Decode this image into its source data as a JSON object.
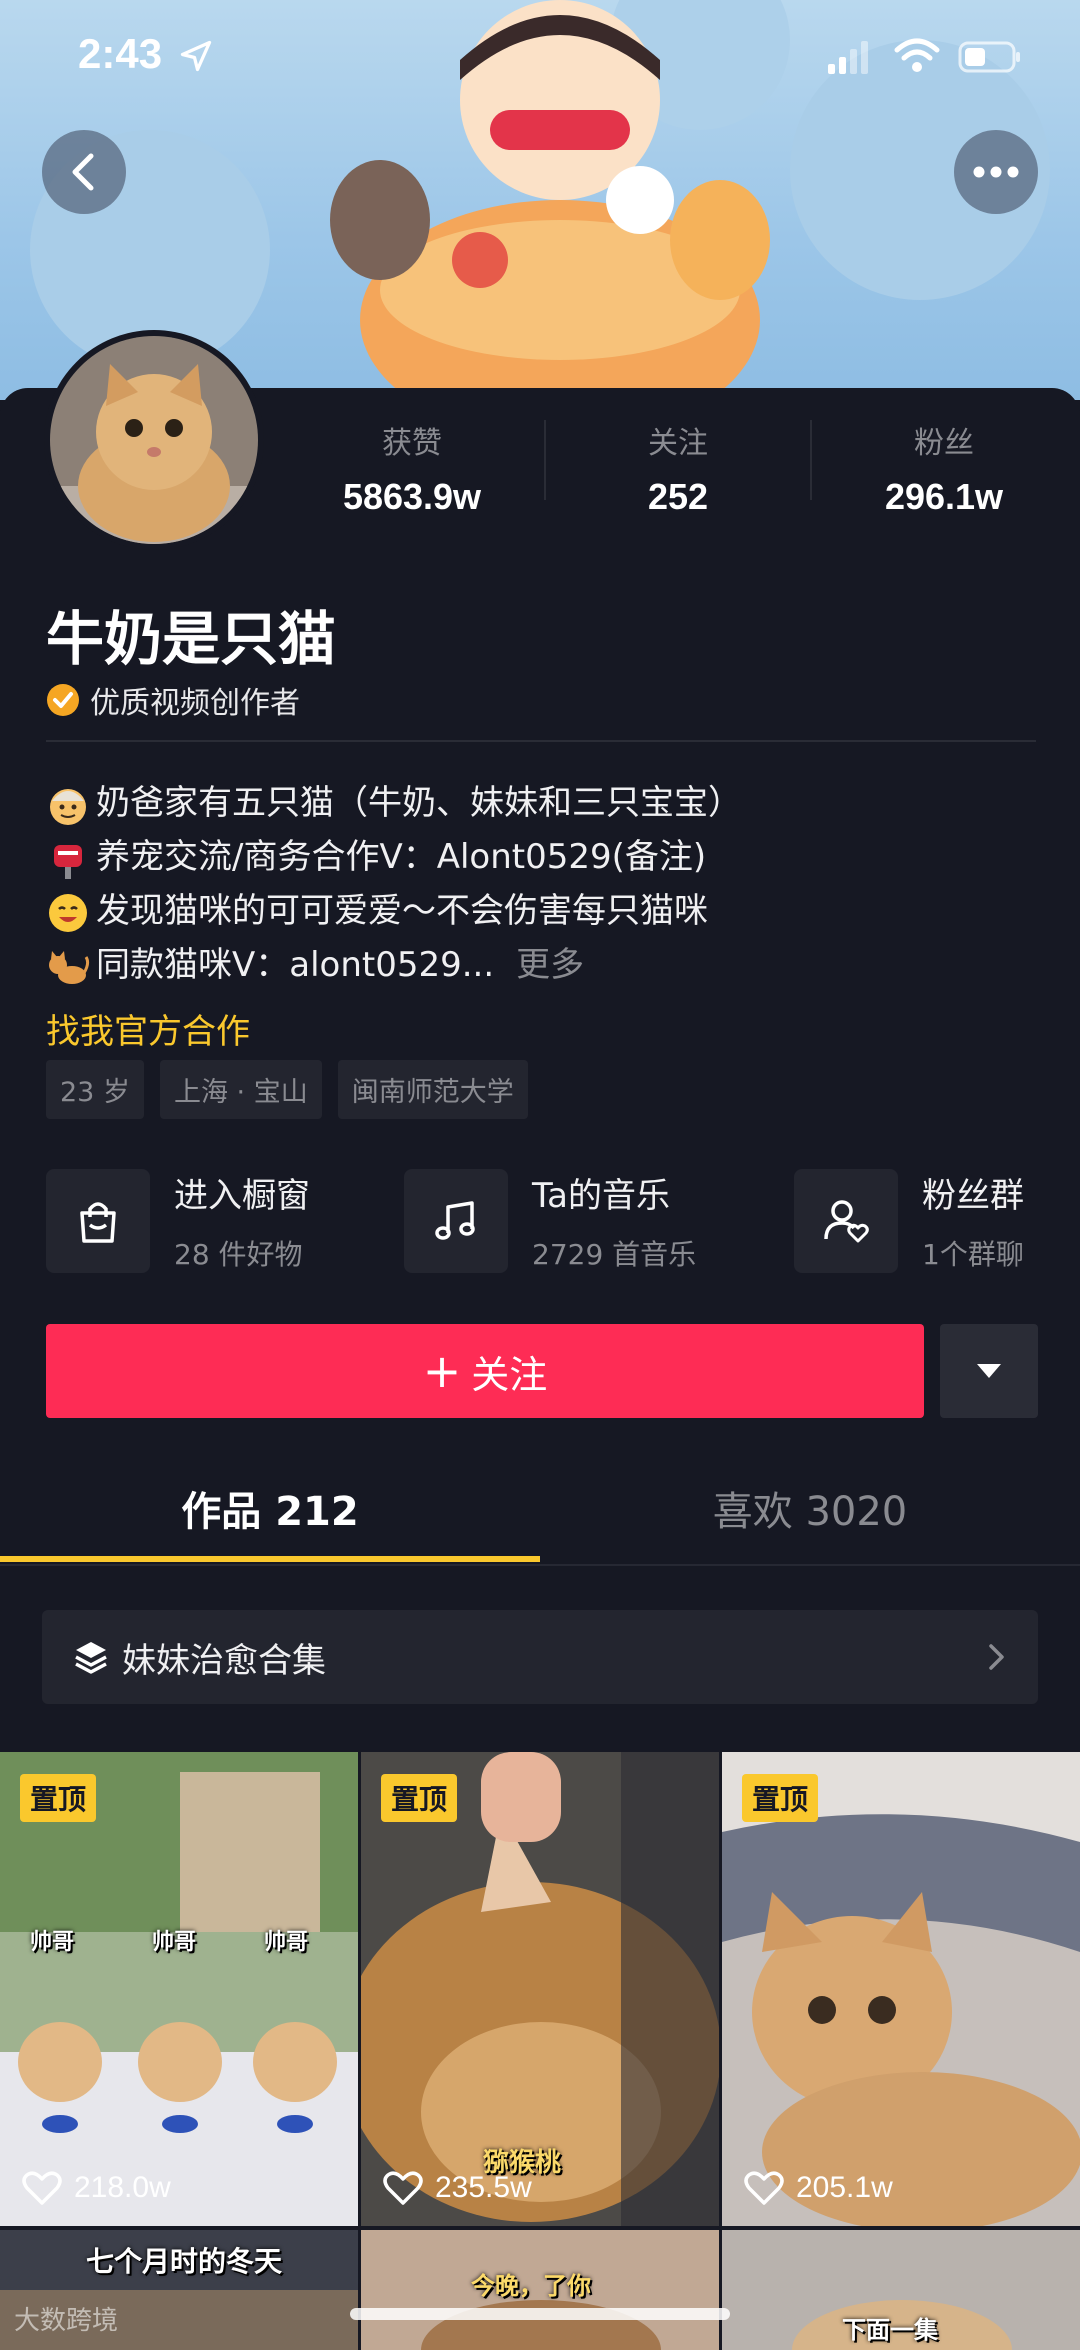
{
  "status_bar": {
    "time": "2:43"
  },
  "profile": {
    "nickname": "牛奶是只猫",
    "verify_label": "优质视频创作者",
    "stats": [
      {
        "label": "获赞",
        "value": "5863.9w"
      },
      {
        "label": "关注",
        "value": "252"
      },
      {
        "label": "粉丝",
        "value": "296.1w"
      }
    ],
    "bio": [
      {
        "icon": "old-man-emoji",
        "text": "奶爸家有五只猫（牛奶、妹妹和三只宝宝）"
      },
      {
        "icon": "postbox-emoji",
        "text": "养宠交流/商务合作V：Alont0529(备注)"
      },
      {
        "icon": "smiling-face-emoji",
        "text": "发现猫咪的可可爱爱～不会伤害每只猫咪"
      },
      {
        "icon": "cat-emoji",
        "text": "同款猫咪V：alont0529..."
      }
    ],
    "bio_more": "更多",
    "official_link": "找我官方合作",
    "tags": [
      "23 岁",
      "上海 · 宝山",
      "闽南师范大学"
    ]
  },
  "features": [
    {
      "icon": "shopping-bag-icon",
      "title": "进入橱窗",
      "subtitle": "28 件好物"
    },
    {
      "icon": "music-note-icon",
      "title": "Ta的音乐",
      "subtitle": "2729 首音乐"
    },
    {
      "icon": "fan-group-icon",
      "title": "粉丝群",
      "subtitle": "1个群聊"
    }
  ],
  "actions": {
    "follow_plus": "+",
    "follow_label": "关注"
  },
  "tabs": [
    {
      "label": "作品 212",
      "active": true
    },
    {
      "label": "喜欢 3020",
      "active": false
    }
  ],
  "collection": {
    "label": "妹妹治愈合集"
  },
  "videos": [
    {
      "pinned": true,
      "pin_label": "置顶",
      "likes": "218.0w",
      "captions": [
        "帅哥",
        "帅哥",
        "帅哥"
      ]
    },
    {
      "pinned": true,
      "pin_label": "置顶",
      "likes": "235.5w",
      "captions": [
        "猕猴桃"
      ]
    },
    {
      "pinned": true,
      "pin_label": "置顶",
      "likes": "205.1w",
      "captions": []
    },
    {
      "pinned": false,
      "caption": "七个月时的冬天"
    },
    {
      "pinned": false,
      "caption": "今晚，了你"
    },
    {
      "pinned": false,
      "caption": "下面一集"
    }
  ],
  "watermark": "大数跨境",
  "colors": {
    "accent": "#fe2c55",
    "highlight": "#fac82d",
    "background": "#161823"
  }
}
